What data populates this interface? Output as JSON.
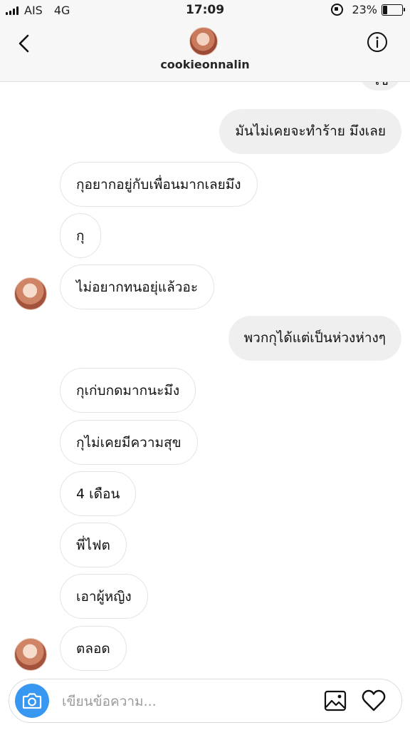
{
  "status_bar": {
    "carrier": "AIS",
    "network": "4G",
    "time": "17:09",
    "battery_percent": "23%",
    "battery_level": 0.23
  },
  "header": {
    "username": "cookieonnalin"
  },
  "messages": [
    {
      "sender": "me",
      "text": "ไข"
    },
    {
      "sender": "me",
      "text": "มันไม่เคยจะทำร้าย มึงเลย"
    },
    {
      "sender": "them",
      "text": "กุอยากอยู่กับเพื่อนมากเลยมึง"
    },
    {
      "sender": "them",
      "text": "กุ"
    },
    {
      "sender": "them",
      "text": "ไม่อยากทนอยุ่แล้วอะ"
    },
    {
      "sender": "me",
      "text": "พวกกุได้แต่เป็นห่วงห่างๆ"
    },
    {
      "sender": "them",
      "text": "กุเก่บกดมากนะมึง"
    },
    {
      "sender": "them",
      "text": "กุไม่เคยมีความสุข"
    },
    {
      "sender": "them",
      "text": "4 เดือน"
    },
    {
      "sender": "them",
      "text": "พี่ไฟต"
    },
    {
      "sender": "them",
      "text": "เอาผู้หญิง"
    },
    {
      "sender": "them",
      "text": "ตลอด"
    }
  ],
  "composer": {
    "placeholder": "เขียนข้อความ..."
  },
  "colors": {
    "accent": "#3897f0",
    "sent_bubble": "#efefef",
    "received_border": "#e3e3e3",
    "header_bg": "#f7f7f7"
  },
  "icons": {
    "back": "chevron-left-icon",
    "info": "info-icon",
    "camera": "camera-icon",
    "gallery": "image-icon",
    "like": "heart-icon"
  }
}
